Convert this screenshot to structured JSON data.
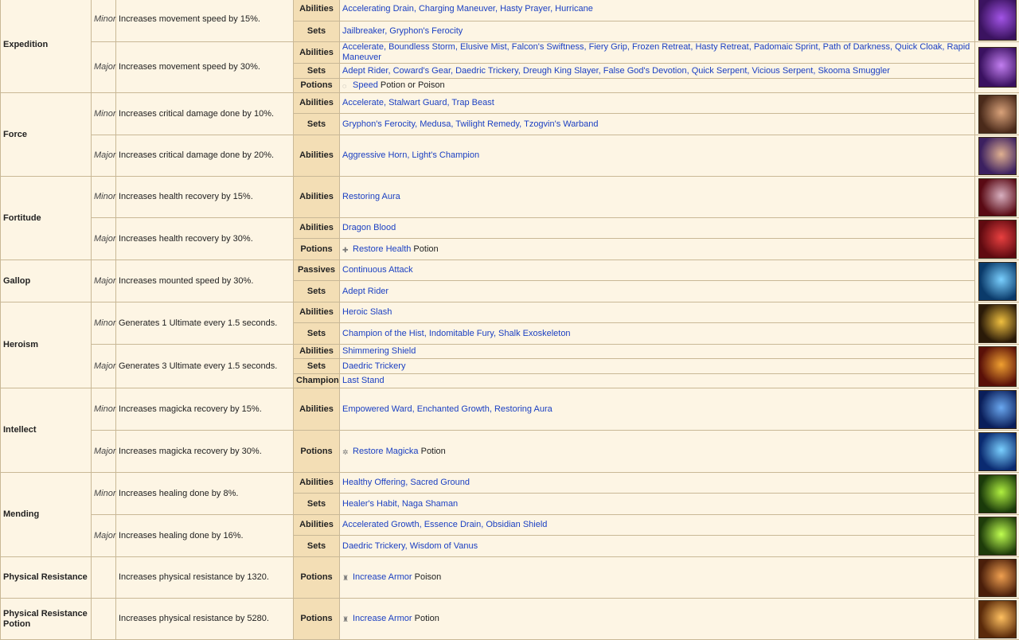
{
  "table_rows": [
    {
      "name": "Expedition",
      "tier": "Minor",
      "desc": "Increases movement speed by 15%.",
      "cat": "Abilities",
      "sources": "Accelerating Drain, Charging Maneuver, Hasty Prayer, Hurricane",
      "icon": "expedition-minor-icon",
      "colors": [
        "#3b1360",
        "#a254e6"
      ]
    },
    {
      "cat": "Sets",
      "sources": "Jailbreaker, Gryphon's Ferocity"
    },
    {
      "tier": "Major",
      "desc": "Increases movement speed by 30%.",
      "cat": "Abilities",
      "sources": "Accelerate, Boundless Storm, Elusive Mist, Falcon's Swiftness, Fiery Grip, Frozen Retreat, Hasty Retreat, Padomaic Sprint, Path of Darkness, Quick Cloak, Rapid Maneuver",
      "icon": "expedition-major-icon",
      "colors": [
        "#3a1160",
        "#c27ef0"
      ]
    },
    {
      "cat": "Sets",
      "sources": "Adept Rider, Coward's Gear, Daedric Trickery, Dreugh King Slayer, False God's Devotion, Quick Serpent, Vicious Serpent, Skooma Smuggler"
    },
    {
      "cat": "Potions",
      "potion_icon": "speed-potion-icon",
      "glyph": "◌",
      "link": "Speed",
      "rest": " Potion or Poison"
    },
    {
      "name": "Force",
      "tier": "Minor",
      "desc": "Increases critical damage done by 10%.",
      "cat": "Abilities",
      "sources": "Accelerate, Stalwart Guard, Trap Beast",
      "icon": "force-minor-icon",
      "colors": [
        "#4a2a1a",
        "#d9a27a"
      ]
    },
    {
      "cat": "Sets",
      "sources": "Gryphon's Ferocity, Medusa, Twilight Remedy, Tzogvin's Warband"
    },
    {
      "tier": "Major",
      "desc": "Increases critical damage done by 20%.",
      "cat": "Abilities",
      "sources": "Aggressive Horn, Light's Champion",
      "icon": "force-major-icon",
      "colors": [
        "#3c2060",
        "#e0b090"
      ]
    },
    {
      "name": "Fortitude",
      "tier": "Minor",
      "desc": "Increases health recovery by 15%.",
      "cat": "Abilities",
      "sources": "Restoring Aura",
      "icon": "fortitude-minor-icon",
      "colors": [
        "#5a0a14",
        "#d8b0c0"
      ]
    },
    {
      "tier": "Major",
      "desc": "Increases health recovery by 30%.",
      "cat": "Abilities",
      "sources": "Dragon Blood",
      "icon": "fortitude-major-icon",
      "colors": [
        "#600a10",
        "#e84040"
      ]
    },
    {
      "cat": "Potions",
      "potion_icon": "restore-health-potion-icon",
      "glyph": "✚",
      "link": "Restore Health",
      "rest": " Potion"
    },
    {
      "name": "Gallop",
      "tier": "Major",
      "desc": "Increases mounted speed by 30%.",
      "cat": "Passives",
      "sources": "Continuous Attack",
      "icon": "gallop-major-icon",
      "colors": [
        "#0a3a6a",
        "#7ad0ff"
      ]
    },
    {
      "cat": "Sets",
      "sources": "Adept Rider"
    },
    {
      "name": "Heroism",
      "tier": "Minor",
      "desc": "Generates 1 Ultimate every 1.5 seconds.",
      "cat": "Abilities",
      "sources": "Heroic Slash",
      "icon": "heroism-minor-icon",
      "colors": [
        "#2a1a08",
        "#f0c040"
      ]
    },
    {
      "cat": "Sets",
      "sources": "Champion of the Hist, Indomitable Fury, Shalk Exoskeleton"
    },
    {
      "tier": "Major",
      "desc": "Generates 3 Ultimate every 1.5 seconds.",
      "cat": "Abilities",
      "sources": "Shimmering Shield",
      "icon": "heroism-major-icon",
      "colors": [
        "#5a1008",
        "#f0a030"
      ]
    },
    {
      "cat": "Sets",
      "sources": "Daedric Trickery"
    },
    {
      "cat": "Champion",
      "sources": "Last Stand"
    },
    {
      "name": "Intellect",
      "tier": "Minor",
      "desc": "Increases magicka recovery by 15%.",
      "cat": "Abilities",
      "sources": "Empowered Ward, Enchanted Growth, Restoring Aura",
      "icon": "intellect-minor-icon",
      "colors": [
        "#0a1e5a",
        "#6aa8f0"
      ]
    },
    {
      "tier": "Major",
      "desc": "Increases magicka recovery by 30%.",
      "cat": "Potions",
      "potion_icon": "restore-magicka-potion-icon",
      "glyph": "✲",
      "link": "Restore Magicka",
      "rest": " Potion",
      "icon": "intellect-major-icon",
      "colors": [
        "#0a2a70",
        "#7ad0ff"
      ]
    },
    {
      "name": "Mending",
      "tier": "Minor",
      "desc": "Increases healing done by 8%.",
      "cat": "Abilities",
      "sources": "Healthy Offering, Sacred Ground",
      "icon": "mending-minor-icon",
      "colors": [
        "#1a3a0a",
        "#b0f040"
      ]
    },
    {
      "cat": "Sets",
      "sources": "Healer's Habit, Naga Shaman"
    },
    {
      "tier": "Major",
      "desc": "Increases healing done by 16%.",
      "cat": "Abilities",
      "sources": "Accelerated Growth, Essence Drain, Obsidian Shield",
      "icon": "mending-major-icon",
      "colors": [
        "#1e3c0a",
        "#c0ff50"
      ]
    },
    {
      "cat": "Sets",
      "sources": "Daedric Trickery, Wisdom of Vanus"
    },
    {
      "name": "Physical Resistance",
      "tier": "",
      "desc": "Increases physical resistance by 1320.",
      "cat": "Potions",
      "potion_icon": "increase-armor-poison-icon",
      "glyph": "♜",
      "link": "Increase Armor",
      "rest": " Poison",
      "icon": "physical-resistance-icon",
      "colors": [
        "#4a1e0a",
        "#f0a050"
      ]
    },
    {
      "name": "Physical Resistance Potion",
      "tier": "",
      "desc": "Increases physical resistance by 5280.",
      "cat": "Potions",
      "potion_icon": "increase-armor-potion-icon",
      "glyph": "♜",
      "link": "Increase Armor",
      "rest": " Potion",
      "icon": "physical-resistance-potion-icon",
      "colors": [
        "#5a2a0a",
        "#ffc060"
      ]
    }
  ]
}
